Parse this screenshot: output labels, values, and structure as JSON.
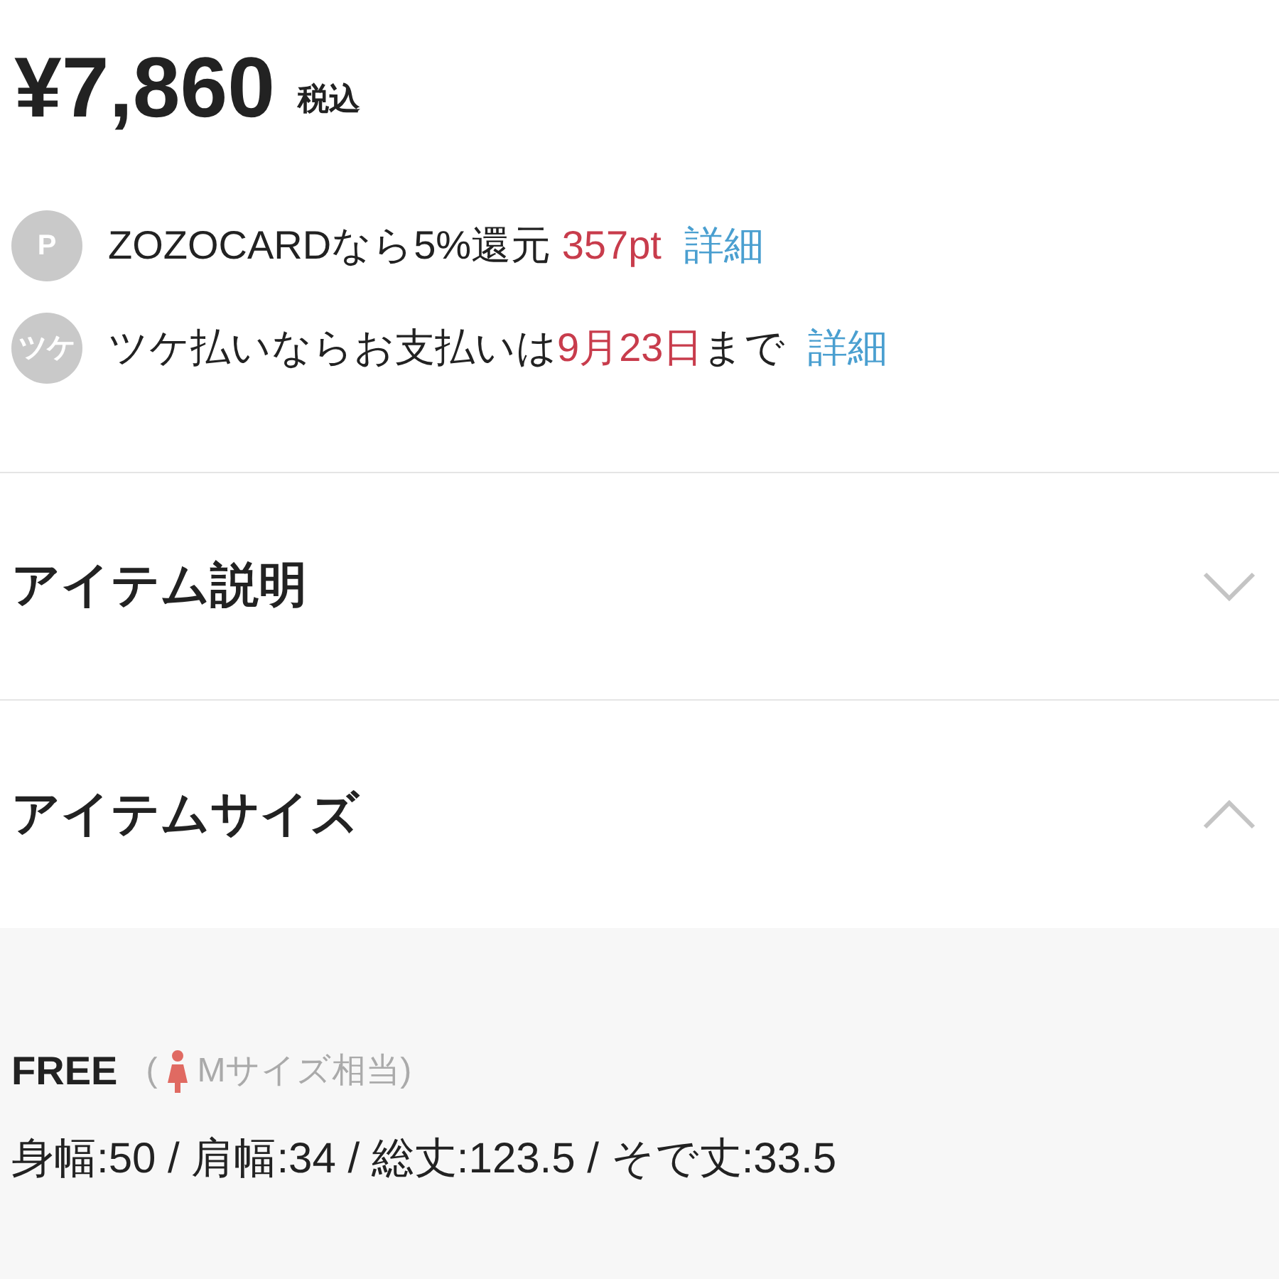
{
  "price": {
    "amount": "¥7,860",
    "tax_note": "税込"
  },
  "notes": [
    {
      "badge": "P",
      "segments": [
        {
          "text": "ZOZOCARDなら5%還元 ",
          "kind": "plain"
        },
        {
          "text": "357pt",
          "kind": "highlight"
        }
      ],
      "link": "詳細"
    },
    {
      "badge": "ツケ",
      "segments": [
        {
          "text": "ツケ払いならお支払いは",
          "kind": "plain"
        },
        {
          "text": "9月23日",
          "kind": "highlight"
        },
        {
          "text": "まで",
          "kind": "plain"
        }
      ],
      "link": "詳細"
    }
  ],
  "sections": [
    {
      "title": "アイテム説明",
      "expanded": false
    },
    {
      "title": "アイテムサイズ",
      "expanded": true
    }
  ],
  "size": {
    "label": "FREE",
    "open_paren": "(",
    "equivalent": "Mサイズ相当)",
    "measurements": "身幅:50 / 肩幅:34 / 総丈:123.5 / そで丈:33.5"
  }
}
